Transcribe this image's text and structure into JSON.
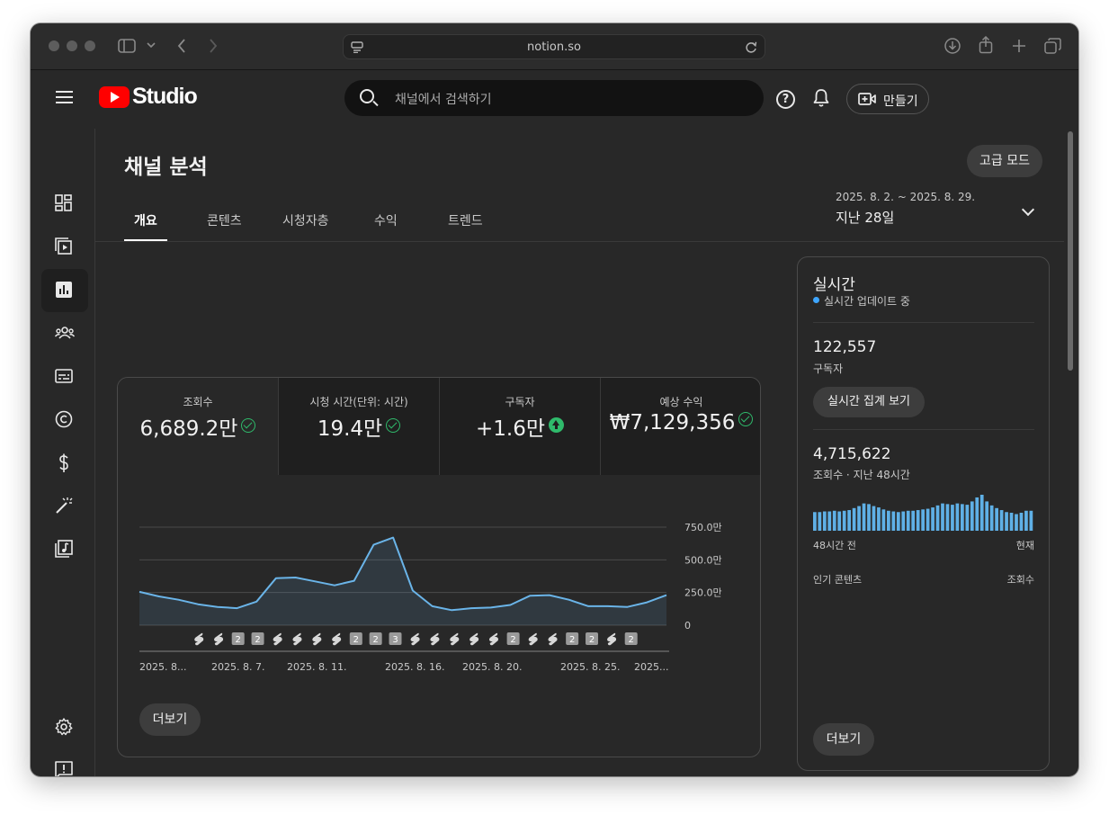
{
  "browser": {
    "url": "notion.so"
  },
  "header": {
    "logo_text": "Studio",
    "search_placeholder": "채널에서 검색하기",
    "create_label": "만들기"
  },
  "page": {
    "title": "채널 분석",
    "advanced_mode_label": "고급 모드",
    "tabs": [
      {
        "label": "개요",
        "active": true
      },
      {
        "label": "콘텐츠",
        "active": false
      },
      {
        "label": "시청자층",
        "active": false
      },
      {
        "label": "수익",
        "active": false
      },
      {
        "label": "트렌드",
        "active": false
      }
    ],
    "date_range": "2025. 8. 2. ~ 2025. 8. 29.",
    "date_label": "지난 28일"
  },
  "metrics": [
    {
      "label": "조회수",
      "value": "6,689.2만",
      "status": "check"
    },
    {
      "label": "시청 시간(단위: 시간)",
      "value": "19.4만",
      "status": "check"
    },
    {
      "label": "구독자",
      "value": "+1.6만",
      "status": "up"
    },
    {
      "label": "예상 수익",
      "value": "₩7,129,356",
      "status": "check"
    }
  ],
  "more_label": "더보기",
  "chart_data": {
    "type": "area",
    "x_tick_labels": [
      "2025. 8...",
      "2025. 8. 7.",
      "2025. 8. 11.",
      "2025. 8. 16.",
      "2025. 8. 20.",
      "2025. 8. 25.",
      "2025..."
    ],
    "y_tick_labels": [
      "750.0만",
      "500.0만",
      "250.0만",
      "0"
    ],
    "ylim": [
      0,
      7500000
    ],
    "grid": true,
    "values": [
      2550000,
      2200000,
      1950000,
      1600000,
      1400000,
      1300000,
      1800000,
      3600000,
      3650000,
      3350000,
      3050000,
      3400000,
      6150000,
      6700000,
      2650000,
      1450000,
      1150000,
      1300000,
      1350000,
      1550000,
      2250000,
      2300000,
      1950000,
      1450000,
      1450000,
      1400000,
      1750000,
      2300000
    ],
    "markers": [
      "s",
      "s",
      "2",
      "2",
      "s",
      "s",
      "s",
      "s",
      "2",
      "2",
      "3",
      "s",
      "s",
      "s",
      "s",
      "s",
      "2",
      "s",
      "s",
      "2",
      "2",
      "s",
      "2"
    ],
    "color": "#6ab4e8"
  },
  "realtime": {
    "title": "실시간",
    "status": "실시간 업데이트 중",
    "subscribers": "122,557",
    "subscribers_label": "구독자",
    "view_button": "실시간 집계 보기",
    "views": "4,715,622",
    "views_label": "조회수 · 지난 48시간",
    "bars": [
      28,
      28,
      29,
      29,
      30,
      29,
      30,
      31,
      34,
      37,
      41,
      40,
      37,
      35,
      32,
      30,
      29,
      28,
      29,
      30,
      30,
      31,
      32,
      33,
      35,
      38,
      41,
      40,
      39,
      41,
      40,
      39,
      44,
      50,
      54,
      44,
      38,
      34,
      31,
      28,
      27,
      25,
      27,
      30,
      30
    ],
    "axis_left": "48시간 전",
    "axis_right": "현재",
    "top_content_label": "인기 콘텐츠",
    "top_content_metric": "조회수",
    "more_label": "더보기"
  }
}
